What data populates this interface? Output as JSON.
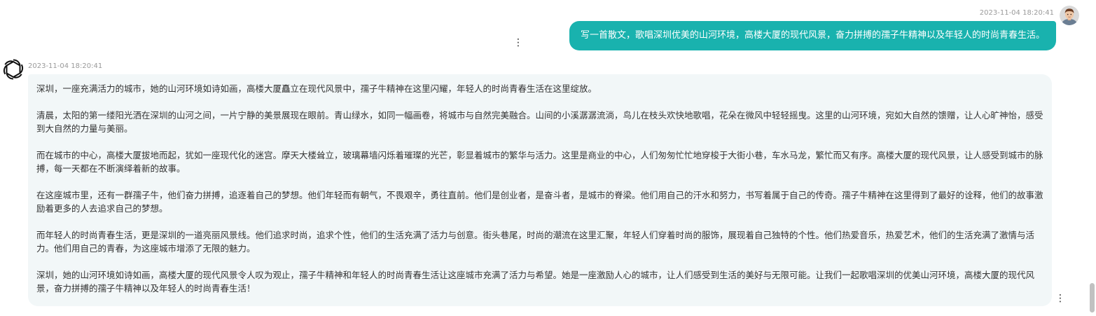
{
  "user_message": {
    "timestamp": "2023-11-04 18:20:41",
    "text": "写一首散文，歌唱深圳优美的山河环境，高楼大厦的现代风景，奋力拼搏的孺子牛精神以及年轻人的时尚青春生活。",
    "avatar": "user-avatar",
    "menu_icon": "⋮"
  },
  "bot_message": {
    "timestamp": "2023-11-04 18:20:41",
    "avatar": "openai-logo-icon",
    "menu_icon": "⋮",
    "paragraphs": [
      "深圳，一座充满活力的城市，她的山河环境如诗如画，高楼大厦矗立在现代风景中，孺子牛精神在这里闪耀，年轻人的时尚青春生活在这里绽放。",
      "清晨，太阳的第一缕阳光洒在深圳的山河之间，一片宁静的美景展现在眼前。青山绿水，如同一幅画卷，将城市与自然完美融合。山间的小溪潺潺流淌，鸟儿在枝头欢快地歌唱，花朵在微风中轻轻摇曳。这里的山河环境，宛如大自然的馈赠，让人心旷神怡，感受到大自然的力量与美丽。",
      "而在城市的中心，高楼大厦拔地而起，犹如一座现代化的迷宫。摩天大楼耸立，玻璃幕墙闪烁着璀璨的光芒，彰显着城市的繁华与活力。这里是商业的中心，人们匆匆忙忙地穿梭于大街小巷，车水马龙，繁忙而又有序。高楼大厦的现代风景，让人感受到城市的脉搏，每一天都在不断演绎着新的故事。",
      "在这座城市里，还有一群孺子牛，他们奋力拼搏，追逐着自己的梦想。他们年轻而有朝气，不畏艰辛，勇往直前。他们是创业者，是奋斗者，是城市的脊梁。他们用自己的汗水和努力，书写着属于自己的传奇。孺子牛精神在这里得到了最好的诠释，他们的故事激励着更多的人去追求自己的梦想。",
      "而年轻人的时尚青春生活，更是深圳的一道亮丽风景线。他们追求时尚，追求个性，他们的生活充满了活力与创意。街头巷尾，时尚的潮流在这里汇聚，年轻人们穿着时尚的服饰，展现着自己独特的个性。他们热爱音乐，热爱艺术，他们的生活充满了激情与活力。他们用自己的青春，为这座城市增添了无限的魅力。",
      "深圳，她的山河环境如诗如画，高楼大厦的现代风景令人叹为观止，孺子牛精神和年轻人的时尚青春生活让这座城市充满了活力与希望。她是一座激励人心的城市，让人们感受到生活的美好与无限可能。让我们一起歌唱深圳的优美山河环境，高楼大厦的现代风景，奋力拼搏的孺子牛精神以及年轻人的时尚青春生活！"
    ]
  },
  "colors": {
    "user_bubble": "#19b2ae",
    "bot_bubble": "#f2f7f8",
    "timestamp": "#9a9a9a"
  }
}
